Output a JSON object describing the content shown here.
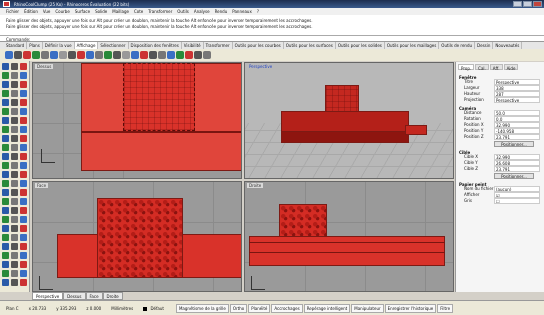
{
  "window": {
    "title": "RhinoCoolClump (25 Ko) - Rhinoceros Évaluation (22 bits)"
  },
  "menu": [
    "Fichier",
    "Édition",
    "Vue",
    "Courbe",
    "Surface",
    "Solide",
    "Maillage",
    "Cote",
    "Transformer",
    "Outils",
    "Analyse",
    "Rendu",
    "Panneaux",
    "?"
  ],
  "command": {
    "history": [
      "Faire glisser des objets, appuyer une fois sur Alt pour créer un doublon, maintenir la touche Alt enfoncée pour inverser temporairement les accrochages.",
      "Faire glisser des objets, appuyer une fois sur Alt pour créer un doublon, maintenir la touche Alt enfoncée pour inverser temporairement les accrochages."
    ],
    "prompt": "Commande:"
  },
  "toolbar_tabs": [
    "Standard",
    "Plans",
    "Définir la vue",
    "Affichage",
    "Sélectionner",
    "Disposition des fenêtres",
    "Visibilité",
    "Transformer",
    "Outils pour les courbes",
    "Outils pour les surfaces",
    "Outils pour les solides",
    "Outils pour les maillages",
    "Outils de rendu",
    "Dessin",
    "Nouveautés"
  ],
  "toolbar_tabs_active": 3,
  "viewports": {
    "top": "Dessus",
    "perspective": "Perspective",
    "front": "Face",
    "right": "Droite"
  },
  "viewport_tabs": [
    "Perspective",
    "Dessus",
    "Face",
    "Droite"
  ],
  "viewport_tabs_active": 0,
  "panel": {
    "tabs": [
      "Prop.",
      "Cal.",
      "Aff.",
      "Aide"
    ],
    "sections": {
      "fenetre": {
        "title": "Fenêtre",
        "rows": [
          [
            "Titre",
            "Perspective"
          ],
          [
            "Largeur",
            "338"
          ],
          [
            "Hauteur",
            "287"
          ],
          [
            "Projection",
            "Perspective"
          ]
        ]
      },
      "camera": {
        "title": "Caméra",
        "rows": [
          [
            "Distance focale",
            "50.0"
          ],
          [
            "Rotation",
            "0.0"
          ],
          [
            "Position X",
            "32.990"
          ],
          [
            "Position Y",
            "-140.958"
          ],
          [
            "Position Z",
            "23.791"
          ],
          [
            "Position",
            "Positionner..."
          ]
        ]
      },
      "cible": {
        "title": "Cible",
        "rows": [
          [
            "Cible X",
            "32.990"
          ],
          [
            "Cible Y",
            "26.608"
          ],
          [
            "Cible Z",
            "23.791"
          ],
          [
            "Position",
            "Positionner..."
          ]
        ]
      },
      "arriere": {
        "title": "Papier peint",
        "rows": [
          [
            "Nom du fichier",
            "(aucun)"
          ],
          [
            "Afficher",
            "☑"
          ],
          [
            "Gris",
            "☐"
          ]
        ]
      }
    }
  },
  "status": {
    "plan": "Plan C",
    "coords": [
      "x 20.733",
      "y 335.293",
      "z 0.000"
    ],
    "units": "Millimètres",
    "layer": "Défaut",
    "toggles": [
      "Magnétisme de la grille",
      "Ortho",
      "Planéité",
      "Accrochages",
      "Repérage intelligent",
      "Manipulateur",
      "Enregistrer l'historique",
      "Filtre"
    ]
  },
  "colors": {
    "model_red": "#d9322a",
    "viewport_gray": "#9a9a9a",
    "title_blue": "#1c2d4e"
  }
}
